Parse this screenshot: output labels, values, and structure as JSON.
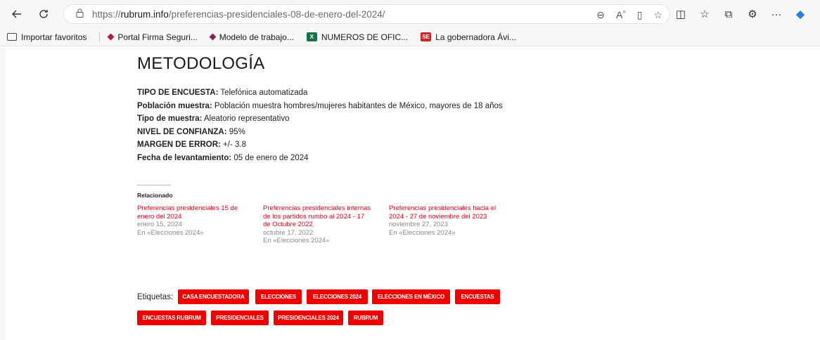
{
  "browser": {
    "url_prefix": "https://",
    "url_host": "rubrum.info",
    "url_path": "/preferencias-presidenciales-08-de-enero-del-2024/",
    "icons": [
      "back-icon",
      "reload-icon",
      "lock-icon",
      "zoom-icon",
      "read-aloud-icon",
      "immersive-reader-icon",
      "favorite-star-icon",
      "split-screen-icon",
      "favorites-icon",
      "collections-icon",
      "extensions-icon",
      "more-icon",
      "copilot-icon"
    ]
  },
  "favorites": [
    {
      "label": "Importar favoritos"
    },
    {
      "label": "Portal Firma Seguri..."
    },
    {
      "label": "Modelo de trabajo..."
    },
    {
      "label": "NUMEROS DE OFIC..."
    },
    {
      "label": "La gobernadora Ávi..."
    }
  ],
  "article": {
    "heading": "METODOLOGÍA",
    "methodology": [
      {
        "label": "TIPO DE ENCUESTA:",
        "value": " Telefónica automatizada"
      },
      {
        "label": "Población muestra:",
        "value": " Población muestra hombres/mujeres habitantes de México, mayores de 18 años"
      },
      {
        "label": "Tipo de muestra:",
        "value": " Aleatorio representativo"
      },
      {
        "label": "NIVEL DE CONFIANZA:",
        "value": " 95%"
      },
      {
        "label": "MARGEN DE ERROR:",
        "value": " +/- 3.8"
      },
      {
        "label": "Fecha de levantamiento:",
        "value": " 05 de enero de 2024"
      }
    ]
  },
  "related": {
    "heading": "Relacionado",
    "items": [
      {
        "title_line1": "Preferencias presidenciales 15 de",
        "title_line2": "enero del 2024",
        "title_line3": "",
        "date": "enero 15, 2024",
        "category": "En «Elecciones 2024»"
      },
      {
        "title_line1": "Preferencias presidenciales internas",
        "title_line2": "de los partidos rumbo al 2024 - 17",
        "title_line3": "de Octubre 2022",
        "date": "octubre 17, 2022",
        "category": "En «Elecciones 2024»"
      },
      {
        "title_line1": "Preferencias presidenciales hacia el",
        "title_line2": "2024 - 27 de noviembre del 2023",
        "title_line3": "",
        "date": "noviembre 27, 2023",
        "category": "En «Elecciones 2024»"
      }
    ]
  },
  "tags": {
    "label": "Etiquetas:",
    "items": [
      "CASA ENCUESTADORA",
      "ELECCIONES",
      "ELECCIONES 2024",
      "ELECCIONES EN MÉXICO",
      "ENCUESTAS",
      "ENCUESTAS RUBRUM",
      "PRESIDENCIALES",
      "PRESIDENCIALES 2024",
      "RUBRUM"
    ],
    "color": "#f00000"
  }
}
